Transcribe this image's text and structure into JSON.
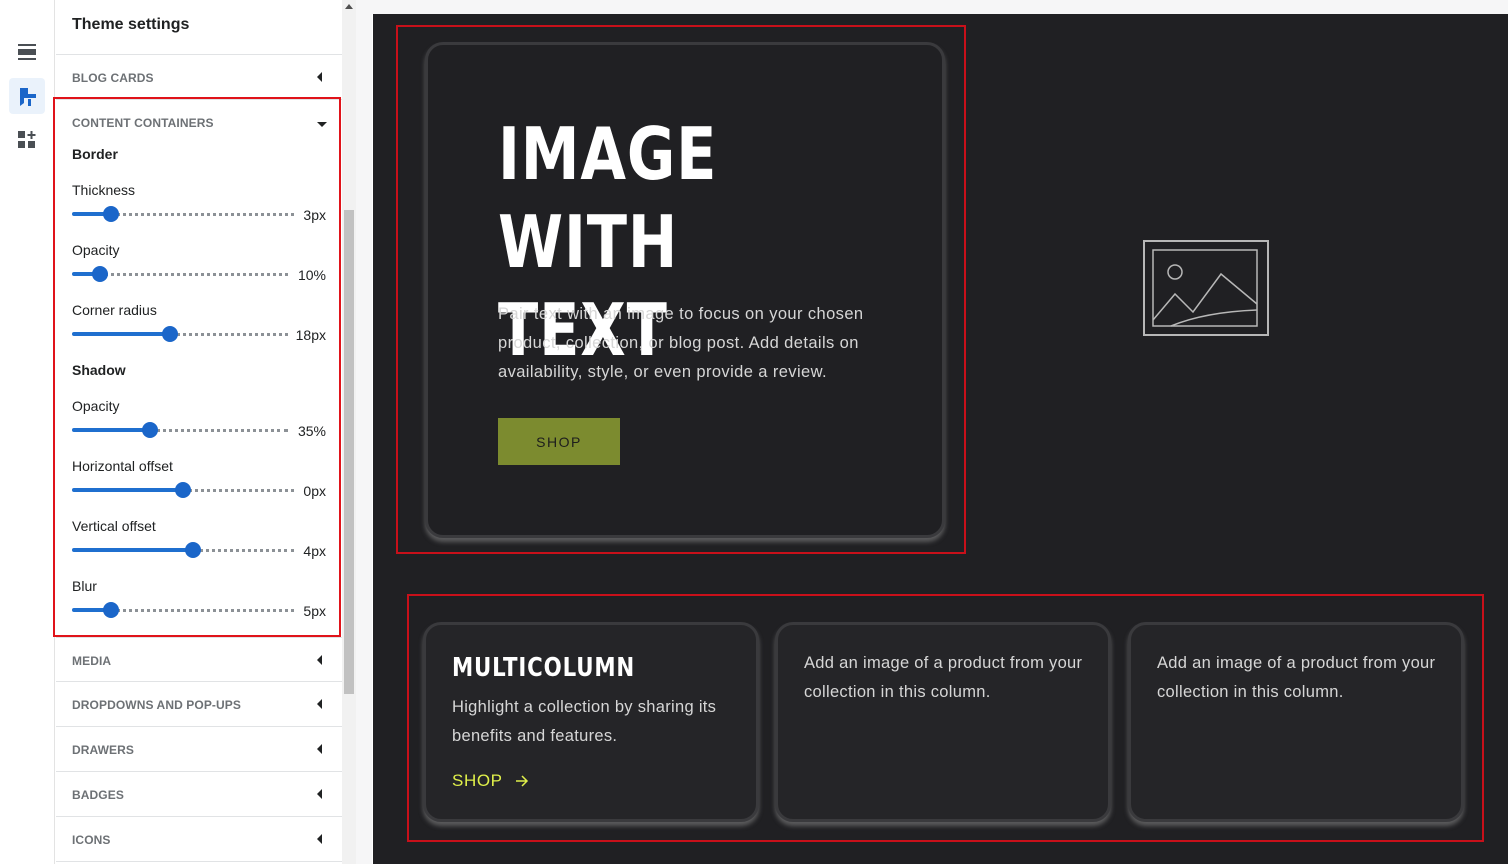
{
  "panel": {
    "title": "Theme settings"
  },
  "sections": {
    "blog_cards": "BLOG CARDS",
    "content_containers": "CONTENT CONTAINERS",
    "media": "MEDIA",
    "dropdowns": "DROPDOWNS AND POP-UPS",
    "drawers": "DRAWERS",
    "badges": "BADGES",
    "icons": "ICONS"
  },
  "content_containers": {
    "border_heading": "Border",
    "shadow_heading": "Shadow",
    "thickness": {
      "label": "Thickness",
      "value": "3px",
      "fraction": 0.15
    },
    "border_opacity": {
      "label": "Opacity",
      "value": "10%",
      "fraction": 0.1
    },
    "corner_radius": {
      "label": "Corner radius",
      "value": "18px",
      "fraction": 0.45
    },
    "shadow_opacity": {
      "label": "Opacity",
      "value": "35%",
      "fraction": 0.35
    },
    "horizontal_offset": {
      "label": "Horizontal offset",
      "value": "0px",
      "fraction": 0.5
    },
    "vertical_offset": {
      "label": "Vertical offset",
      "value": "4px",
      "fraction": 0.55
    },
    "blur": {
      "label": "Blur",
      "value": "5px",
      "fraction": 0.15
    }
  },
  "preview": {
    "image_with_text": {
      "heading_line1": "IMAGE WITH",
      "heading_line2": "TEXT",
      "body": "Pair text with an image to focus on your chosen product, collection, or blog post. Add details on availability, style, or even provide a review.",
      "button": "SHOP"
    },
    "multicolumn": {
      "title": "MULTICOLUMN",
      "text": "Highlight a collection by sharing its benefits and features.",
      "link": "SHOP",
      "column_text": "Add an image of a product from your collection in this column."
    }
  },
  "colors": {
    "accent": "#1b66c9",
    "preview_bg": "#202023",
    "button_bg": "#7c8b2f",
    "link": "#e0f04a",
    "highlight": "#e0131a"
  }
}
